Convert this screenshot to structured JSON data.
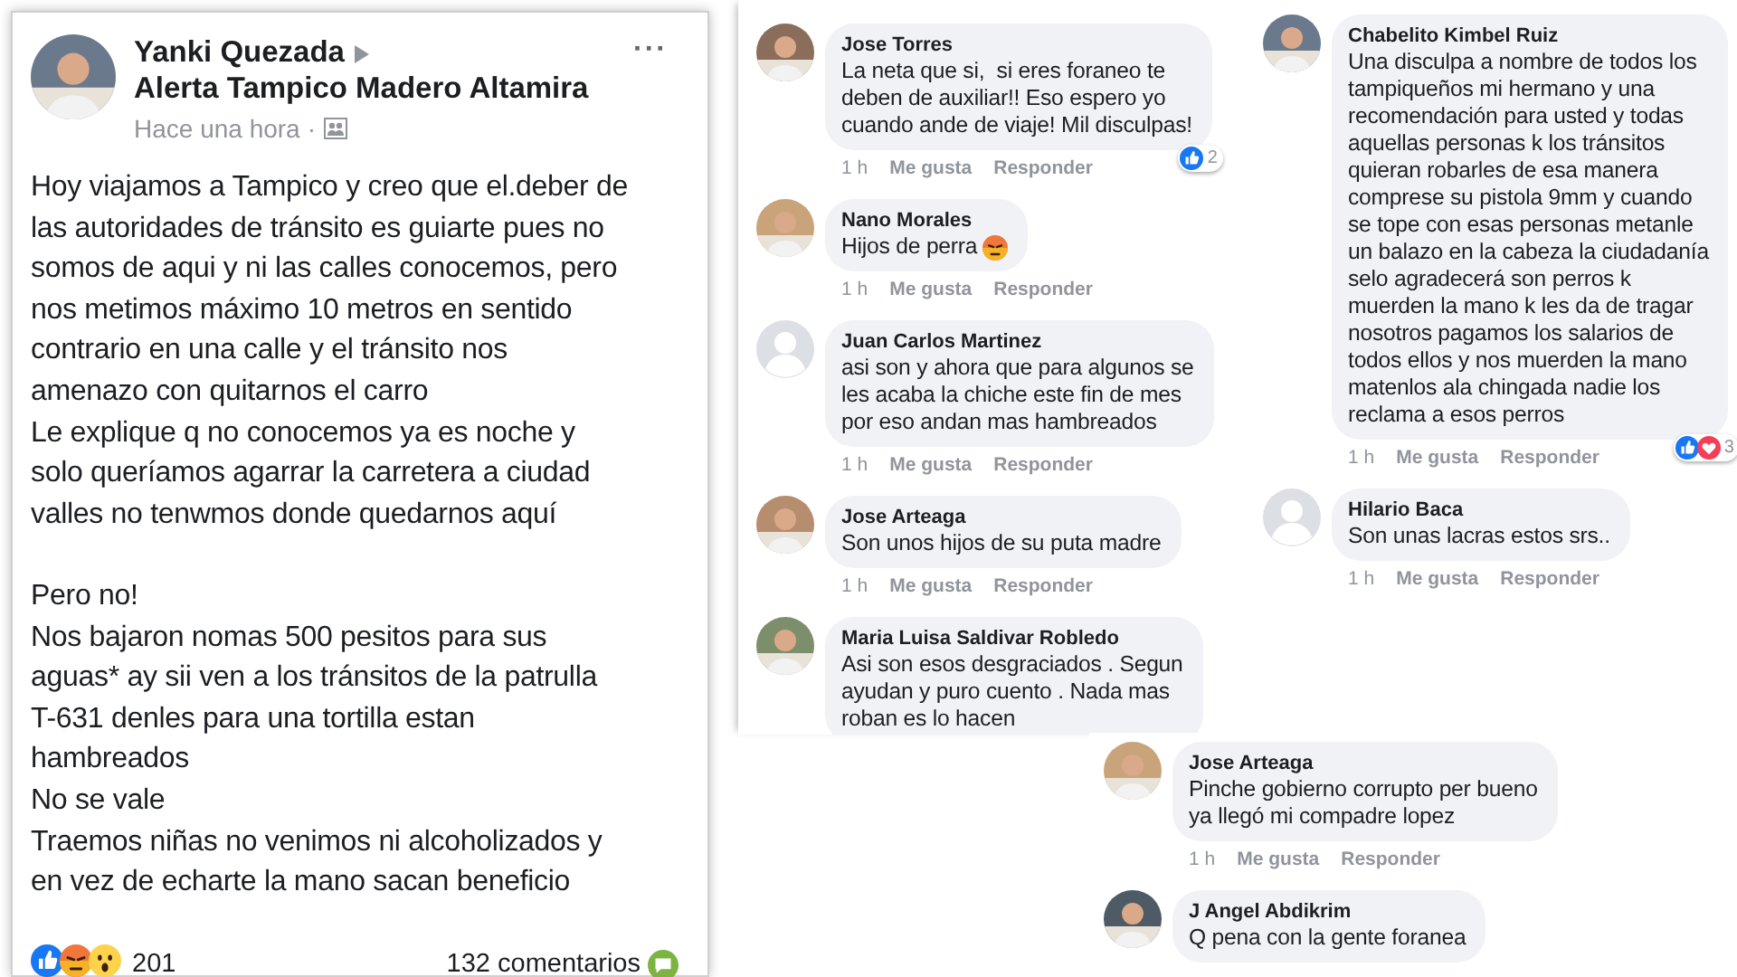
{
  "post": {
    "author": "Yanki Quezada",
    "group": "Alerta Tampico Madero Altamira",
    "more": "···",
    "time": "Hace una hora",
    "separator": "·",
    "paragraphs": [
      "Hoy viajamos a Tampico y creo que el.deber de\nlas autoridades de tránsito es guiarte pues no\nsomos de aqui y ni las calles conocemos, pero\nnos metimos máximo 10 metros en sentido\ncontrario en una calle y el tránsito nos\namenazo con quitarnos el carro\nLe explique q no conocemos ya es noche y\nsolo queríamos agarrar la carretera a ciudad\nvalles no tenwmos donde quedarnos aquí",
      "Pero no!\nNos bajaron nomas 500 pesitos para sus\naguas* ay sii ven a los tránsitos de la patrulla\nT-631 denles para una tortilla estan\nhambreados\nNo se vale\nTraemos niñas no venimos ni alcoholizados y\nen vez de echarte la mano sacan beneficio"
    ],
    "reactions": {
      "icons": [
        {
          "kind": "like"
        },
        {
          "kind": "angry"
        },
        {
          "kind": "wow"
        }
      ],
      "count": "201"
    },
    "comments_link": "132 comentarios"
  },
  "comment_panels": [
    {
      "comments": [
        {
          "author": "Jose Torres",
          "avatar": {
            "kind": "photo"
          },
          "text": "La neta que si,  si eres foraneo te\ndeben de auxiliar!! Eso espero yo\ncuando ande de viaje! Mil disculpas!",
          "time": "1 h",
          "like_label": "Me gusta",
          "reply_label": "Responder",
          "reactions": {
            "icons": [
              {
                "kind": "like"
              }
            ],
            "count": "2"
          }
        },
        {
          "author": "Nano Morales",
          "avatar": {
            "kind": "photo"
          },
          "text": "Hijos de perra",
          "emoji": {
            "kind": "angry"
          },
          "time": "1 h",
          "like_label": "Me gusta",
          "reply_label": "Responder"
        },
        {
          "author": "Juan Carlos Martinez",
          "avatar": {
            "kind": "default"
          },
          "text": "asi son y ahora que para algunos se\nles acaba la chiche este fin de mes\npor eso andan mas hambreados",
          "time": "1 h",
          "like_label": "Me gusta",
          "reply_label": "Responder"
        },
        {
          "author": "Jose Arteaga",
          "avatar": {
            "kind": "photo"
          },
          "text": "Son unos hijos de su puta madre",
          "time": "1 h",
          "like_label": "Me gusta",
          "reply_label": "Responder"
        },
        {
          "author": "Maria Luisa Saldivar Robledo",
          "avatar": {
            "kind": "photo"
          },
          "text": "Asi son esos desgraciados . Segun\nayudan y puro cuento . Nada mas\nroban es lo hacen"
        }
      ]
    },
    {
      "comments": [
        {
          "author": "Chabelito Kimbel Ruiz",
          "avatar": {
            "kind": "photo"
          },
          "text": "Una disculpa a nombre de todos los\ntampiqueños mi hermano y una\nrecomendación para usted y todas\naquellas personas k los tránsitos\nquieran robarles de esa manera\ncomprese su pistola 9mm y cuando\nse tope con esas personas metanle\nun balazo en la cabeza la ciudadanía\nselo agradecerá son perros k\nmuerden la mano k les da de tragar\nnosotros pagamos los salarios de\ntodos ellos y nos muerden la mano\nmatenlos ala chingada nadie los\nreclama a esos perros",
          "time": "1 h",
          "like_label": "Me gusta",
          "reply_label": "Responder",
          "reactions": {
            "icons": [
              {
                "kind": "like"
              },
              {
                "kind": "heart"
              }
            ],
            "count": "3"
          }
        },
        {
          "author": "Hilario Baca",
          "avatar": {
            "kind": "default"
          },
          "text": "Son unas lacras estos srs..",
          "time": "1 h",
          "like_label": "Me gusta",
          "reply_label": "Responder"
        }
      ]
    },
    {
      "comments": [
        {
          "author": "Jose Arteaga",
          "avatar": {
            "kind": "photo"
          },
          "text": "Pinche gobierno corrupto per bueno\nya llegó mi compadre lopez",
          "time": "1 h",
          "like_label": "Me gusta",
          "reply_label": "Responder"
        },
        {
          "author": "J Angel Abdikrim",
          "avatar": {
            "kind": "photo"
          },
          "text": "Q pena con la gente foranea"
        }
      ]
    }
  ]
}
